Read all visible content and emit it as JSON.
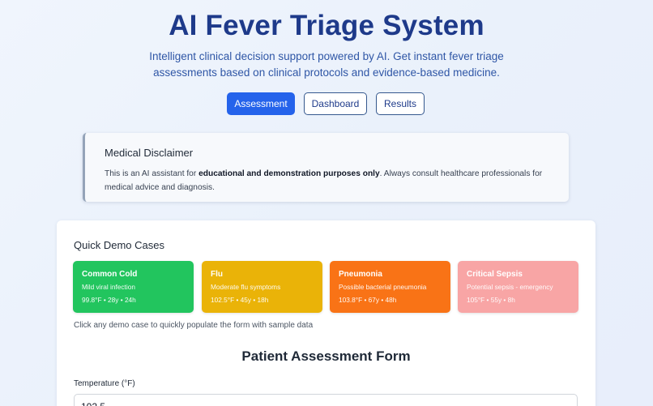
{
  "header": {
    "title": "AI Fever Triage System",
    "subtitle": "Intelligent clinical decision support powered by AI. Get instant fever triage assessments based on clinical protocols and evidence-based medicine."
  },
  "nav": {
    "assessment": "Assessment",
    "dashboard": "Dashboard",
    "results": "Results",
    "active": "Assessment"
  },
  "disclaimer": {
    "title": "Medical Disclaimer",
    "text_before": "This is an AI assistant for ",
    "text_bold": "educational and demonstration purposes only",
    "text_after": ". Always consult healthcare professionals for medical advice and diagnosis."
  },
  "demo": {
    "heading": "Quick Demo Cases",
    "cases": [
      {
        "title": "Common Cold",
        "desc": "Mild viral infection",
        "vitals": "99.8°F • 28y • 24h",
        "color": "#22c55e"
      },
      {
        "title": "Flu",
        "desc": "Moderate flu symptoms",
        "vitals": "102.5°F • 45y • 18h",
        "color": "#eab308"
      },
      {
        "title": "Pneumonia",
        "desc": "Possible bacterial pneumonia",
        "vitals": "103.8°F • 67y • 48h",
        "color": "#f97316"
      },
      {
        "title": "Critical Sepsis",
        "desc": "Potential sepsis - emergency",
        "vitals": "105°F • 55y • 8h",
        "color": "#f8a5a5"
      }
    ],
    "hint": "Click any demo case to quickly populate the form with sample data"
  },
  "form": {
    "title": "Patient Assessment Form",
    "temperature_label": "Temperature (°F)",
    "temperature_value": "102.5"
  },
  "colors": {
    "primary": "#2563eb",
    "title": "#1e3a8a"
  }
}
